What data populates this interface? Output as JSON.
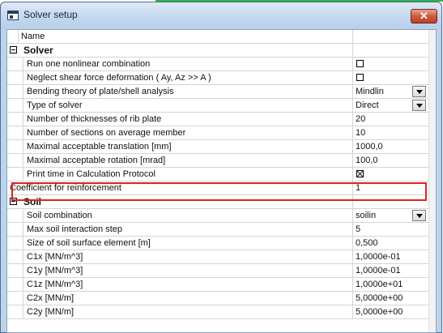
{
  "window": {
    "title": "Solver setup",
    "close_glyph": "✕"
  },
  "header": {
    "name_label": "Name",
    "value_label": ""
  },
  "sections": {
    "solver": {
      "label": "Solver",
      "rows": [
        {
          "name": "Run one nonlinear combination",
          "type": "checkbox",
          "checked": false
        },
        {
          "name": "Neglect shear force deformation ( Ay, Az >> A )",
          "type": "checkbox",
          "checked": false
        },
        {
          "name": "Bending theory of plate/shell analysis",
          "type": "dropdown",
          "value": "Mindlin"
        },
        {
          "name": "Type of solver",
          "type": "dropdown",
          "value": "Direct"
        },
        {
          "name": "Number of thicknesses of rib plate",
          "type": "text",
          "value": "20"
        },
        {
          "name": "Number of sections on average member",
          "type": "text",
          "value": "10"
        },
        {
          "name": "Maximal acceptable translation [mm]",
          "type": "text",
          "value": "1000,0"
        },
        {
          "name": "Maximal acceptable rotation [mrad]",
          "type": "text",
          "value": "100,0"
        },
        {
          "name": "Print time in Calculation Protocol",
          "type": "checkbox",
          "checked": true
        }
      ]
    },
    "reinforcement": {
      "name": "Coefficient for reinforcement",
      "value": "1"
    },
    "soil": {
      "label": "Soil",
      "rows": [
        {
          "name": "Soil combination",
          "type": "dropdown",
          "value": "soilin"
        },
        {
          "name": "Max soil interaction step",
          "type": "text",
          "value": "5"
        },
        {
          "name": "Size of soil surface element [m]",
          "type": "text",
          "value": "0,500"
        },
        {
          "name": "C1x [MN/m^3]",
          "type": "text",
          "value": "1,0000e-01"
        },
        {
          "name": "C1y [MN/m^3]",
          "type": "text",
          "value": "1,0000e-01"
        },
        {
          "name": "C1z [MN/m^3]",
          "type": "text",
          "value": "1,0000e+01"
        },
        {
          "name": "C2x [MN/m]",
          "type": "text",
          "value": "5,0000e+00"
        },
        {
          "name": "C2y [MN/m]",
          "type": "text",
          "value": "5,0000e+00"
        }
      ]
    }
  },
  "colors": {
    "highlight": "#e21f26",
    "title_bar": "#c3d7ee",
    "close_button": "#cf5a3e"
  },
  "icons": {
    "app": "window-icon",
    "close": "close-icon",
    "collapse": "minus-toggle-icon",
    "dropdown": "chevron-down-icon"
  }
}
